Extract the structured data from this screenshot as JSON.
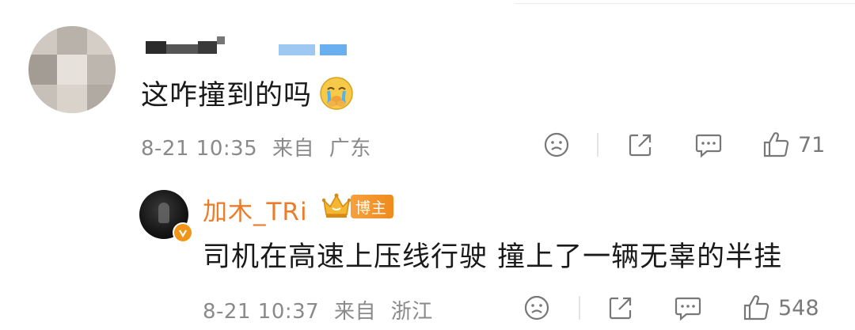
{
  "comment1": {
    "text": "这咋撞到的吗",
    "date": "8-21 10:35",
    "source": "来自",
    "location": "广东",
    "likes": "71"
  },
  "reply": {
    "author": "加木_TRi",
    "badge": "博主",
    "text": "司机在高速上压线行驶 撞上了一辆无辜的半挂",
    "date": "8-21 10:37",
    "source": "来自",
    "location": "浙江",
    "likes": "548"
  },
  "colors": {
    "author_name": "#ea7c2a",
    "badge": "#f08a1c",
    "meta": "#8a8a8a"
  },
  "icons": [
    "dislike-face-icon",
    "share-icon",
    "comment-icon",
    "thumbs-up-icon",
    "crown-icon",
    "verified-icon",
    "emoji-crying-icon"
  ]
}
